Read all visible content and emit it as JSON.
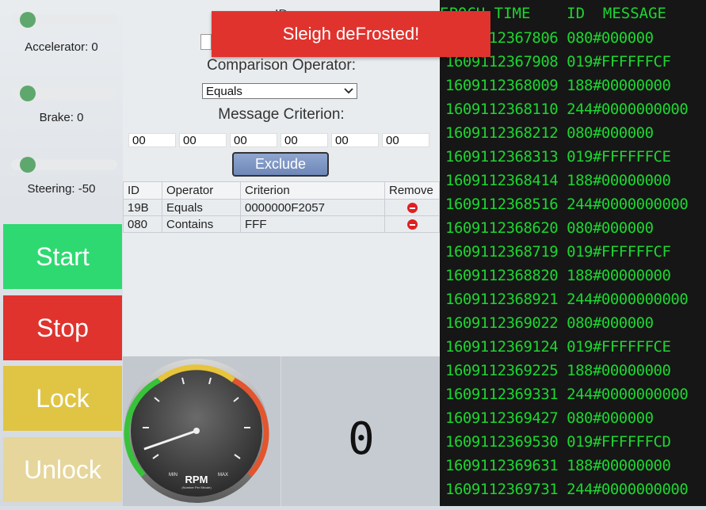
{
  "sliders": [
    {
      "label": "Accelerator: 0",
      "value": 0
    },
    {
      "label": "Brake: 0",
      "value": 0
    },
    {
      "label": "Steering: -50",
      "value": -50
    }
  ],
  "buttons": {
    "start": "Start",
    "stop": "Stop",
    "lock": "Lock",
    "unlock": "Unlock"
  },
  "filter": {
    "id_label": "ID",
    "id_value": "",
    "operator_label": "Comparison Operator:",
    "operator_value": "Equals",
    "criterion_label": "Message Criterion:",
    "criterion_bytes": [
      "00",
      "00",
      "00",
      "00",
      "00",
      "00"
    ],
    "exclude_label": "Exclude"
  },
  "rules_table": {
    "headers": [
      "ID",
      "Operator",
      "Criterion",
      "Remove"
    ],
    "rows": [
      {
        "id": "19B",
        "operator": "Equals",
        "criterion": "0000000F2057"
      },
      {
        "id": "080",
        "operator": "Contains",
        "criterion": "FFF"
      }
    ]
  },
  "gauge": {
    "label": "RPM",
    "subtitle": "(Number Per Minute)",
    "min_label": "MIN",
    "max_label": "MAX",
    "value_fraction": 0.08
  },
  "digit_display": "0",
  "toast": "Sleigh deFrosted!",
  "log": {
    "header": "EPOCH TIME    ID  MESSAGE",
    "rows": [
      "1609112367806 080#000000",
      "1609112367908 019#FFFFFFCF",
      "1609112368009 188#00000000",
      "1609112368110 244#0000000000",
      "1609112368212 080#000000",
      "1609112368313 019#FFFFFFCE",
      "1609112368414 188#00000000",
      "1609112368516 244#0000000000",
      "1609112368620 080#000000",
      "1609112368719 019#FFFFFFCF",
      "1609112368820 188#00000000",
      "1609112368921 244#0000000000",
      "1609112369022 080#000000",
      "1609112369124 019#FFFFFFCE",
      "1609112369225 188#00000000",
      "1609112369331 244#0000000000",
      "1609112369427 080#000000",
      "1609112369530 019#FFFFFFCD",
      "1609112369631 188#00000000",
      "1609112369731 244#0000000000"
    ]
  }
}
